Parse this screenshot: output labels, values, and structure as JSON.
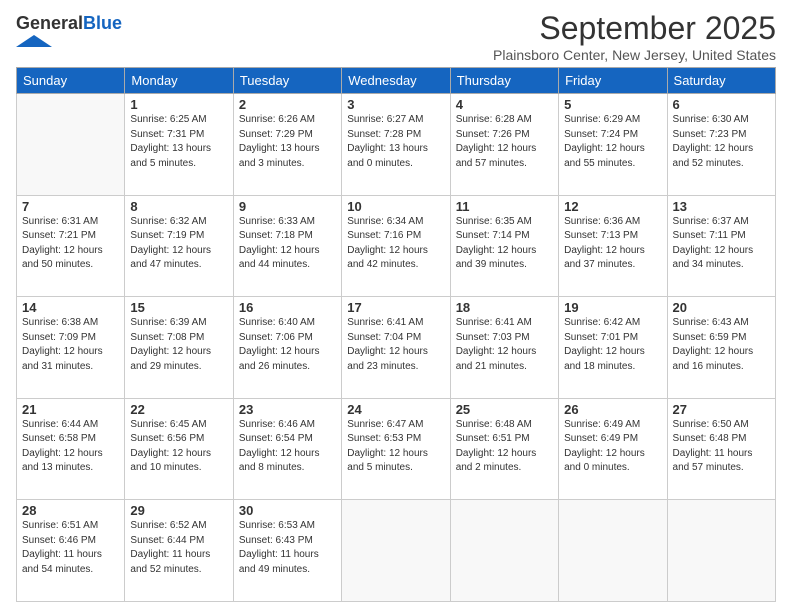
{
  "logo": {
    "general": "General",
    "blue": "Blue"
  },
  "header": {
    "month": "September 2025",
    "location": "Plainsboro Center, New Jersey, United States"
  },
  "days_of_week": [
    "Sunday",
    "Monday",
    "Tuesday",
    "Wednesday",
    "Thursday",
    "Friday",
    "Saturday"
  ],
  "weeks": [
    [
      {
        "day": "",
        "info": ""
      },
      {
        "day": "1",
        "info": "Sunrise: 6:25 AM\nSunset: 7:31 PM\nDaylight: 13 hours\nand 5 minutes."
      },
      {
        "day": "2",
        "info": "Sunrise: 6:26 AM\nSunset: 7:29 PM\nDaylight: 13 hours\nand 3 minutes."
      },
      {
        "day": "3",
        "info": "Sunrise: 6:27 AM\nSunset: 7:28 PM\nDaylight: 13 hours\nand 0 minutes."
      },
      {
        "day": "4",
        "info": "Sunrise: 6:28 AM\nSunset: 7:26 PM\nDaylight: 12 hours\nand 57 minutes."
      },
      {
        "day": "5",
        "info": "Sunrise: 6:29 AM\nSunset: 7:24 PM\nDaylight: 12 hours\nand 55 minutes."
      },
      {
        "day": "6",
        "info": "Sunrise: 6:30 AM\nSunset: 7:23 PM\nDaylight: 12 hours\nand 52 minutes."
      }
    ],
    [
      {
        "day": "7",
        "info": "Sunrise: 6:31 AM\nSunset: 7:21 PM\nDaylight: 12 hours\nand 50 minutes."
      },
      {
        "day": "8",
        "info": "Sunrise: 6:32 AM\nSunset: 7:19 PM\nDaylight: 12 hours\nand 47 minutes."
      },
      {
        "day": "9",
        "info": "Sunrise: 6:33 AM\nSunset: 7:18 PM\nDaylight: 12 hours\nand 44 minutes."
      },
      {
        "day": "10",
        "info": "Sunrise: 6:34 AM\nSunset: 7:16 PM\nDaylight: 12 hours\nand 42 minutes."
      },
      {
        "day": "11",
        "info": "Sunrise: 6:35 AM\nSunset: 7:14 PM\nDaylight: 12 hours\nand 39 minutes."
      },
      {
        "day": "12",
        "info": "Sunrise: 6:36 AM\nSunset: 7:13 PM\nDaylight: 12 hours\nand 37 minutes."
      },
      {
        "day": "13",
        "info": "Sunrise: 6:37 AM\nSunset: 7:11 PM\nDaylight: 12 hours\nand 34 minutes."
      }
    ],
    [
      {
        "day": "14",
        "info": "Sunrise: 6:38 AM\nSunset: 7:09 PM\nDaylight: 12 hours\nand 31 minutes."
      },
      {
        "day": "15",
        "info": "Sunrise: 6:39 AM\nSunset: 7:08 PM\nDaylight: 12 hours\nand 29 minutes."
      },
      {
        "day": "16",
        "info": "Sunrise: 6:40 AM\nSunset: 7:06 PM\nDaylight: 12 hours\nand 26 minutes."
      },
      {
        "day": "17",
        "info": "Sunrise: 6:41 AM\nSunset: 7:04 PM\nDaylight: 12 hours\nand 23 minutes."
      },
      {
        "day": "18",
        "info": "Sunrise: 6:41 AM\nSunset: 7:03 PM\nDaylight: 12 hours\nand 21 minutes."
      },
      {
        "day": "19",
        "info": "Sunrise: 6:42 AM\nSunset: 7:01 PM\nDaylight: 12 hours\nand 18 minutes."
      },
      {
        "day": "20",
        "info": "Sunrise: 6:43 AM\nSunset: 6:59 PM\nDaylight: 12 hours\nand 16 minutes."
      }
    ],
    [
      {
        "day": "21",
        "info": "Sunrise: 6:44 AM\nSunset: 6:58 PM\nDaylight: 12 hours\nand 13 minutes."
      },
      {
        "day": "22",
        "info": "Sunrise: 6:45 AM\nSunset: 6:56 PM\nDaylight: 12 hours\nand 10 minutes."
      },
      {
        "day": "23",
        "info": "Sunrise: 6:46 AM\nSunset: 6:54 PM\nDaylight: 12 hours\nand 8 minutes."
      },
      {
        "day": "24",
        "info": "Sunrise: 6:47 AM\nSunset: 6:53 PM\nDaylight: 12 hours\nand 5 minutes."
      },
      {
        "day": "25",
        "info": "Sunrise: 6:48 AM\nSunset: 6:51 PM\nDaylight: 12 hours\nand 2 minutes."
      },
      {
        "day": "26",
        "info": "Sunrise: 6:49 AM\nSunset: 6:49 PM\nDaylight: 12 hours\nand 0 minutes."
      },
      {
        "day": "27",
        "info": "Sunrise: 6:50 AM\nSunset: 6:48 PM\nDaylight: 11 hours\nand 57 minutes."
      }
    ],
    [
      {
        "day": "28",
        "info": "Sunrise: 6:51 AM\nSunset: 6:46 PM\nDaylight: 11 hours\nand 54 minutes."
      },
      {
        "day": "29",
        "info": "Sunrise: 6:52 AM\nSunset: 6:44 PM\nDaylight: 11 hours\nand 52 minutes."
      },
      {
        "day": "30",
        "info": "Sunrise: 6:53 AM\nSunset: 6:43 PM\nDaylight: 11 hours\nand 49 minutes."
      },
      {
        "day": "",
        "info": ""
      },
      {
        "day": "",
        "info": ""
      },
      {
        "day": "",
        "info": ""
      },
      {
        "day": "",
        "info": ""
      }
    ]
  ]
}
